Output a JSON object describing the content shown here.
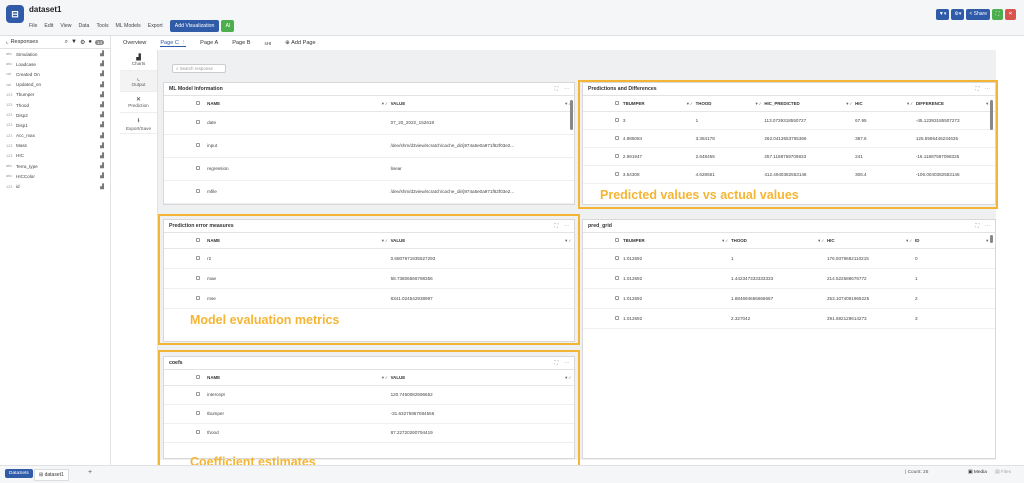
{
  "app": {
    "dataset_title": "dataset1",
    "logo_glyph": "⊟",
    "menu": [
      "File",
      "Edit",
      "View",
      "Data",
      "Tools",
      "ML Models",
      "Export"
    ],
    "add_viz_label": "Add Visualization",
    "ai_label": "AI",
    "share_label": "Share",
    "colors": {
      "brand": "#2f5ba8",
      "green": "#4cae4c",
      "red": "#d9534f",
      "callout": "#f5b534"
    }
  },
  "sidebar": {
    "header": "Responses",
    "count_badge": "14",
    "items": [
      {
        "type": "abc",
        "label": "Simulation"
      },
      {
        "type": "abc",
        "label": "Loadcase"
      },
      {
        "type": "cal",
        "label": "Created On"
      },
      {
        "type": "cal",
        "label": "Updated_on"
      },
      {
        "type": "123",
        "label": "Tbumper"
      },
      {
        "type": "123",
        "label": "Thood"
      },
      {
        "type": "123",
        "label": "Disp2"
      },
      {
        "type": "123",
        "label": "Disp1"
      },
      {
        "type": "123",
        "label": "Acc_max"
      },
      {
        "type": "123",
        "label": "Mass"
      },
      {
        "type": "123",
        "label": "HIC"
      },
      {
        "type": "abc",
        "label": "Terra_type"
      },
      {
        "type": "abc",
        "label": "HICColor"
      },
      {
        "type": "123",
        "label": "id"
      }
    ]
  },
  "tools": [
    "Charts",
    "Output",
    "Prediction",
    "Export/Save"
  ],
  "tabs": [
    "Overview",
    "Page C",
    "Page A",
    "Page B",
    "sHt",
    "Add Page"
  ],
  "search_placeholder": "Search response",
  "panels": {
    "ml_model": {
      "title": "ML Model Information",
      "columns": [
        "NAME",
        "VALUE"
      ],
      "rows": [
        [
          "date",
          "07_20_2022_152618"
        ],
        [
          "input",
          "/dev/shm/d3view/scratch/cache_dir/j974a5e0a971f62f03e2..."
        ],
        [
          "regression",
          "linear"
        ],
        [
          "mfile",
          "/dev/shm/d3view/scratch/cache_dir/j974a5e0a971f62f03e2..."
        ]
      ]
    },
    "pred_diff": {
      "title": "Predictions and Differences",
      "columns": [
        "TBUMPER",
        "THOOD",
        "HIC_PREDICTED",
        "HIC",
        "DIFFERENCE"
      ],
      "rows": [
        [
          "3",
          "1",
          "113.0739318550727",
          "67.95",
          "-45.12393185507273"
        ],
        [
          "4.985084",
          "3.384178",
          "262.0413553765366",
          "387.6",
          "125.5586446234635"
        ],
        [
          "2.991947",
          "2.648456",
          "257.1188759709833",
          "241",
          "-16.11887597098325"
        ],
        [
          "3.54308",
          "4.628561",
          "412.4940382553146",
          "306.4",
          "-106.0040382553146"
        ]
      ]
    },
    "pred_err": {
      "title": "Prediction error measures",
      "columns": [
        "NAME",
        "VALUE"
      ],
      "rows": [
        [
          "r2",
          "0.6807971935527293"
        ],
        [
          "mae",
          "58.73806566798356"
        ],
        [
          "mse",
          "6341.024542938997"
        ]
      ]
    },
    "pred_grid": {
      "title": "pred_grid",
      "columns": [
        "TBUMPER",
        "THOOD",
        "HIC",
        "ID"
      ],
      "rows": [
        [
          "1.012692",
          "1",
          "176.9379682110215",
          "0"
        ],
        [
          "1.012692",
          "1.442347333333333",
          "214.522688676772",
          "1"
        ],
        [
          "1.012692",
          "1.884694666666667",
          "253.1074091965225",
          "2"
        ],
        [
          "1.012692",
          "2.327042",
          "291.692129614273",
          "3"
        ]
      ]
    },
    "coefs": {
      "title": "coefs",
      "columns": [
        "NAME",
        "VALUE"
      ],
      "rows": [
        [
          "intercept",
          "120.7450082596652"
        ],
        [
          "tbumper",
          "-31.63275967084556"
        ],
        [
          "thood",
          "87.22720260794419"
        ]
      ]
    }
  },
  "callouts": {
    "pred_vs_actual": "Predicted values vs actual values",
    "model_eval": "Model evaluation metrics",
    "coef_est": "Coefficient estimates"
  },
  "bottom": {
    "data_tab": "DataSets",
    "dataset_tab": "dataset1",
    "add": "+",
    "count": "Count: 25",
    "media": "Media",
    "files": "Files"
  }
}
